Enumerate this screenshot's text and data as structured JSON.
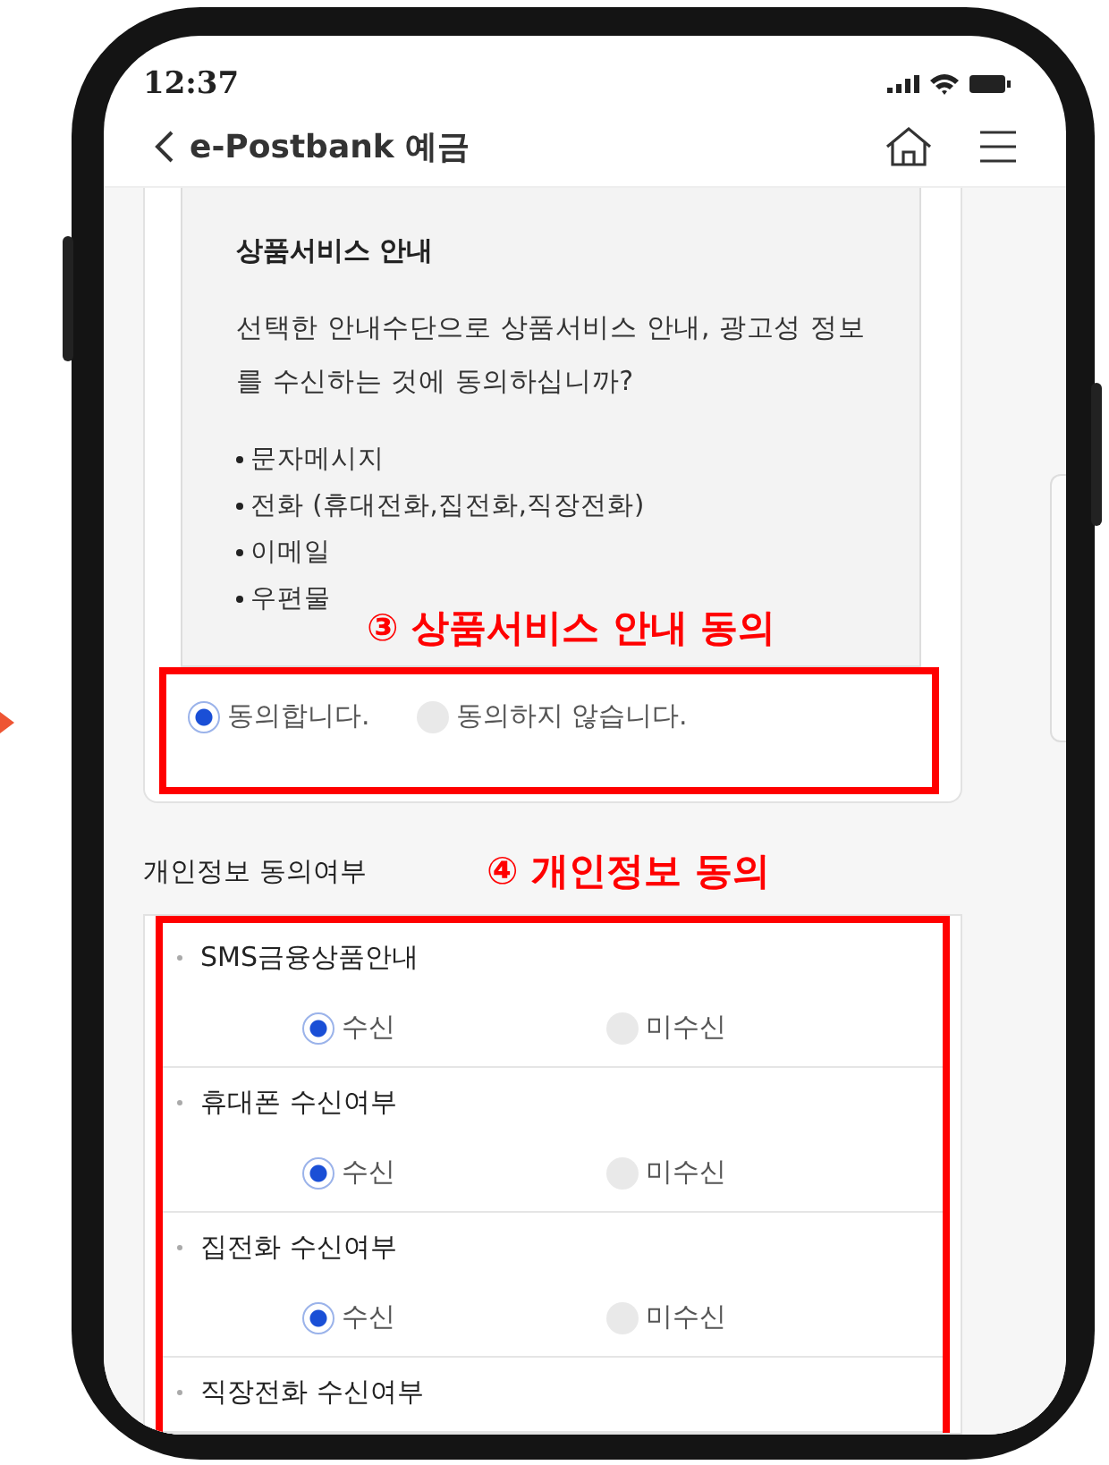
{
  "status_bar": {
    "time": "12:37"
  },
  "header": {
    "title": "e-Postbank 예금"
  },
  "notice": {
    "title": "상품서비스 안내",
    "text": "선택한 안내수단으로 상품서비스 안내, 광고성 정보를 수신하는 것에 동의하십니까?",
    "channels": [
      "문자메시지",
      "전화 (휴대전화,집전화,직장전화)",
      "이메일",
      "우편물"
    ]
  },
  "consent_options": [
    {
      "label": "동의합니다.",
      "selected": true
    },
    {
      "label": "동의하지 않습니다.",
      "selected": false
    }
  ],
  "section_title": "개인정보 동의여부",
  "preferences": [
    {
      "label": "SMS금융상품안내",
      "options": [
        {
          "label": "수신",
          "selected": true
        },
        {
          "label": "미수신",
          "selected": false
        }
      ]
    },
    {
      "label": "휴대폰 수신여부",
      "options": [
        {
          "label": "수신",
          "selected": true
        },
        {
          "label": "미수신",
          "selected": false
        }
      ]
    },
    {
      "label": "집전화 수신여부",
      "options": [
        {
          "label": "수신",
          "selected": true
        },
        {
          "label": "미수신",
          "selected": false
        }
      ]
    },
    {
      "label": "직장전화 수신여부"
    }
  ],
  "annotations": [
    {
      "text": "③ 상품서비스 안내 동의"
    },
    {
      "text": "④ 개인정보 동의"
    }
  ]
}
